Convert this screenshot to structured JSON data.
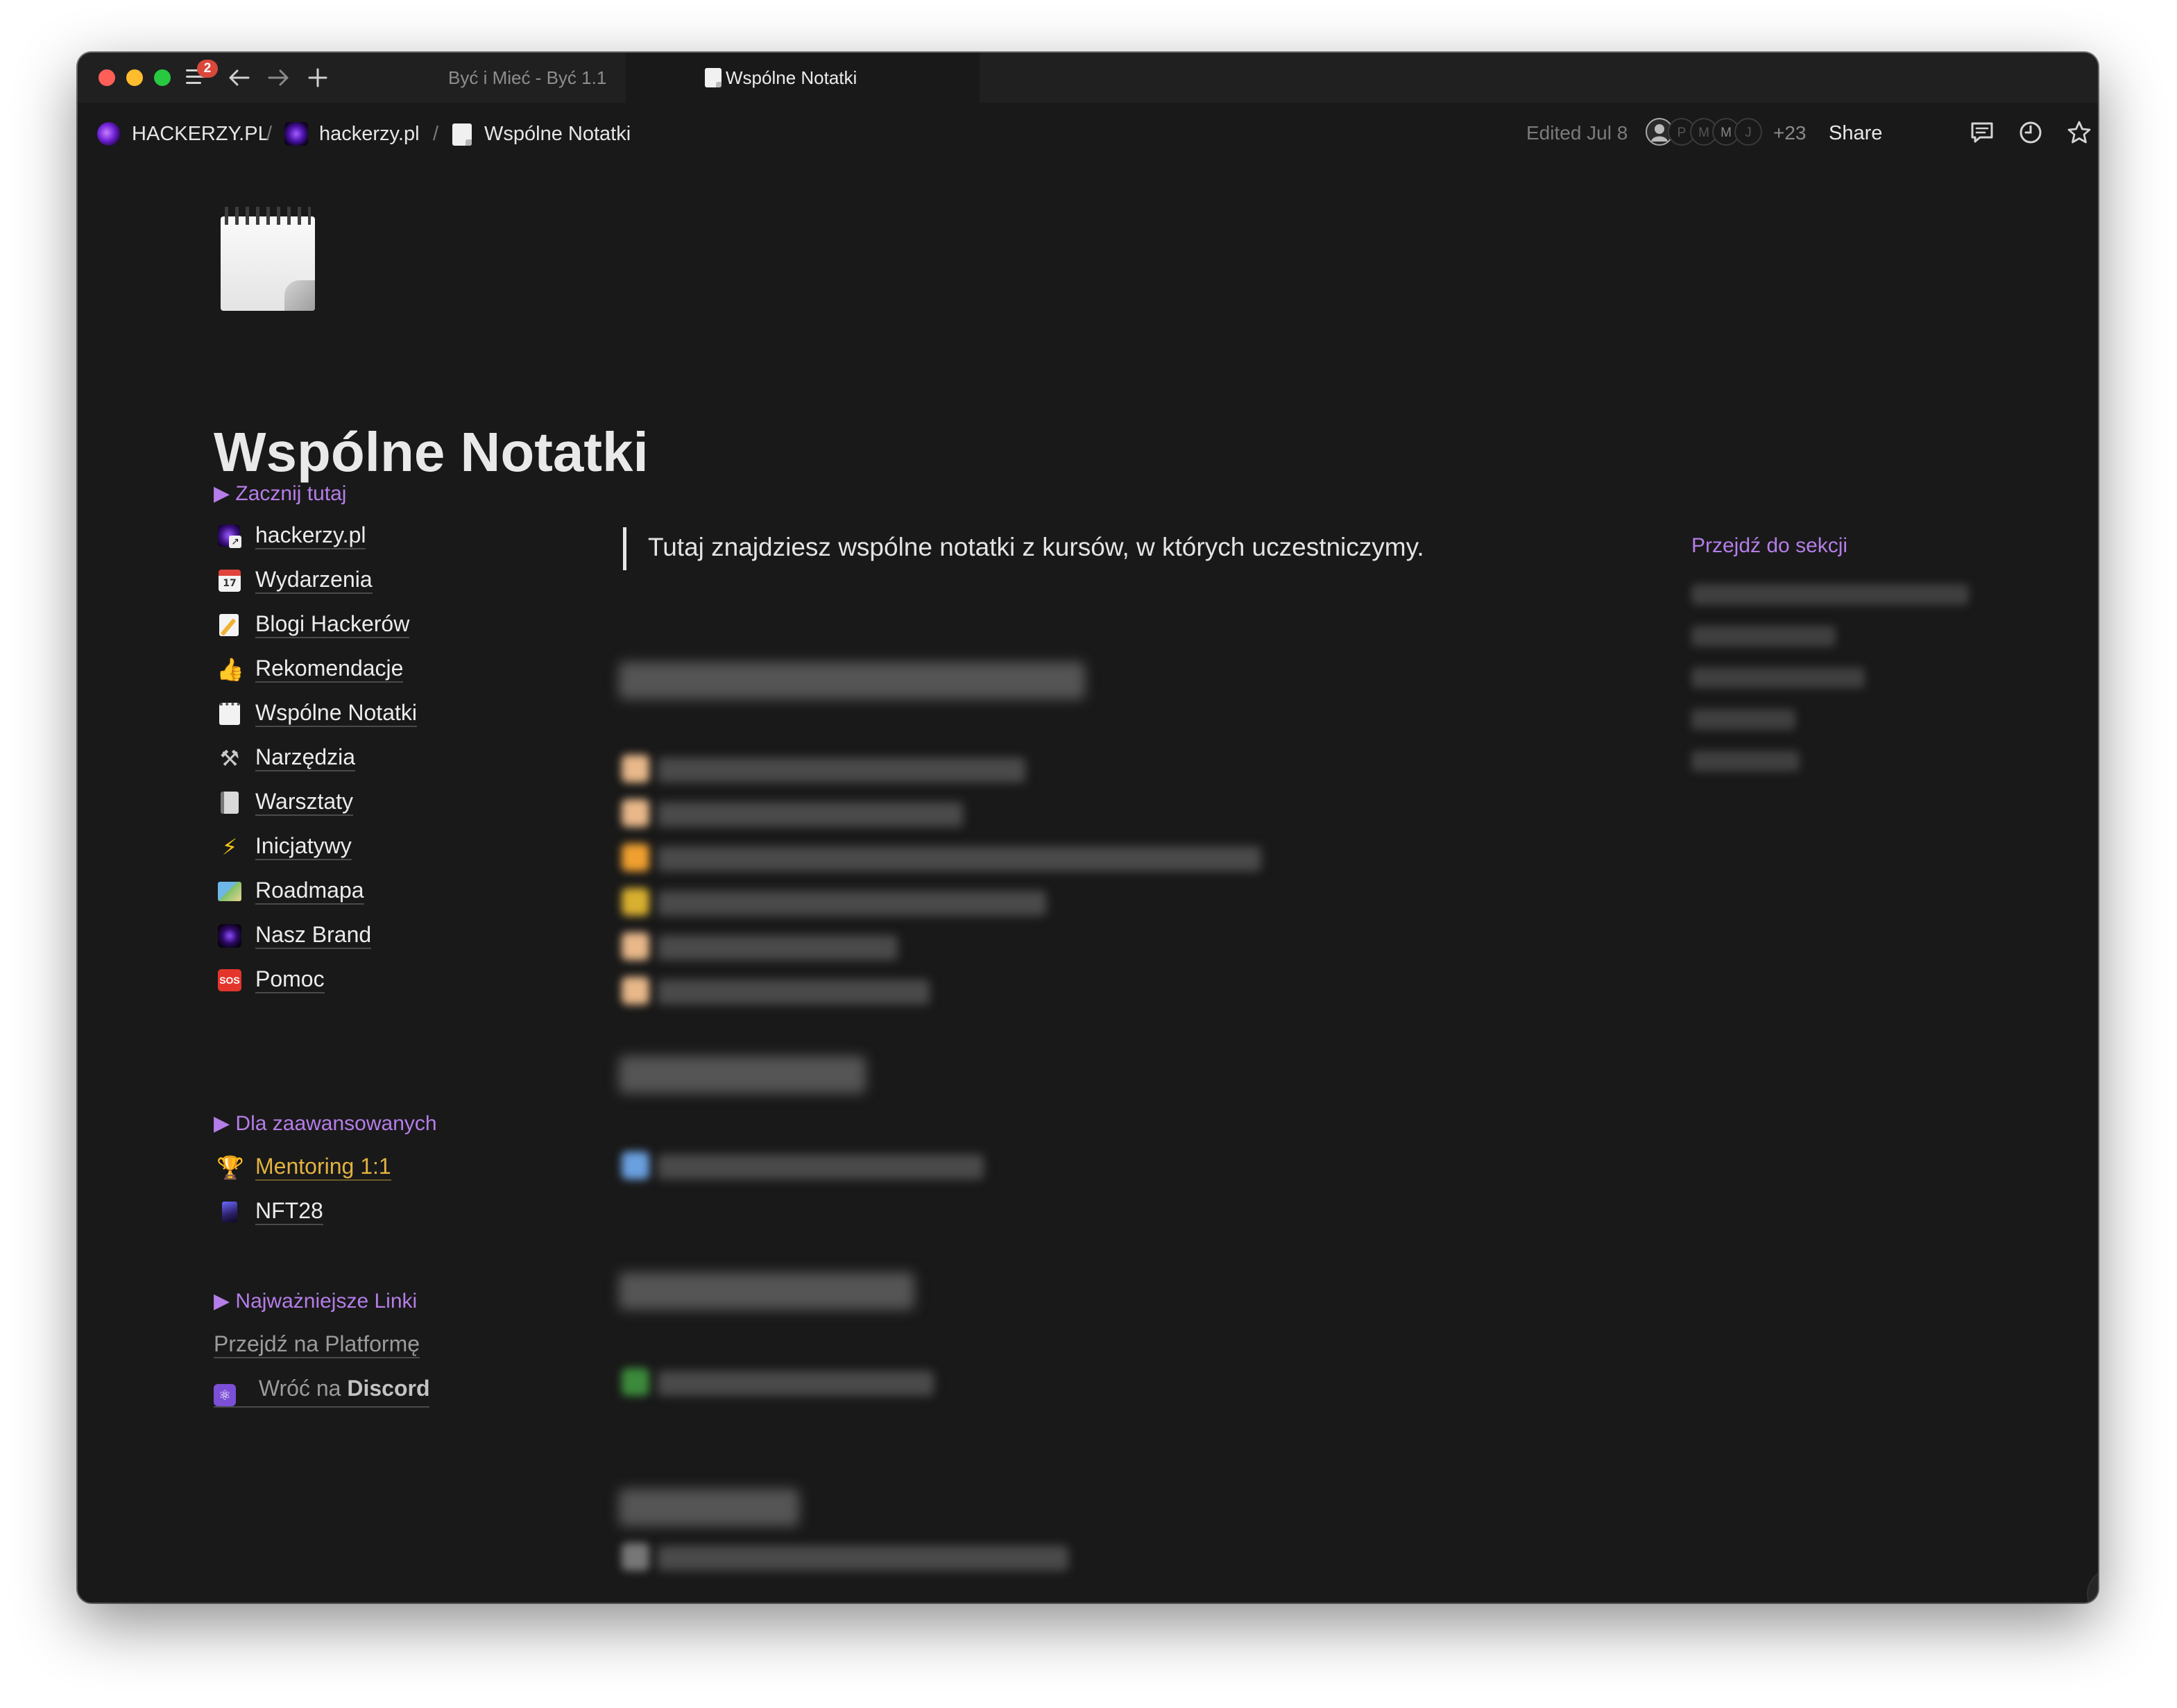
{
  "tabbar": {
    "badge_count": "2",
    "tabs": [
      {
        "label": "Być i Mieć - Być 1.1",
        "active": false
      },
      {
        "label": "Wspólne Notatki",
        "active": true
      }
    ]
  },
  "topbar": {
    "breadcrumbs": [
      {
        "label": "HACKERZY.PL",
        "icon": "hackerzy-logo-icon"
      },
      {
        "label": "hackerzy.pl",
        "icon": "hackerzy-square-icon"
      },
      {
        "label": "Wspólne Notatki",
        "icon": "notepad-icon"
      }
    ],
    "separator": "/",
    "edited": "Edited Jul 8",
    "avatars": [
      "",
      "P",
      "M",
      "M",
      "J"
    ],
    "more_count": "+23",
    "share_label": "Share"
  },
  "page": {
    "icon": "notepad-icon",
    "title": "Wspólne Notatki",
    "quote": "Tutaj znajdziesz wspólne notatki z kursów, w których uczestniczymy."
  },
  "sidebar": {
    "start_heading": "▶ Zacznij tutaj",
    "items": [
      {
        "label": "hackerzy.pl",
        "icon": "hackerzy-link-icon"
      },
      {
        "label": "Wydarzenia",
        "icon": "calendar-icon"
      },
      {
        "label": "Blogi Hackerów",
        "icon": "memo-icon"
      },
      {
        "label": "Rekomendacje",
        "icon": "thumbs-up-icon"
      },
      {
        "label": "Wspólne Notatki",
        "icon": "notepad-icon"
      },
      {
        "label": "Narzędzia",
        "icon": "hammer-pick-icon"
      },
      {
        "label": "Warsztaty",
        "icon": "calendar-tearoff-icon"
      },
      {
        "label": "Inicjatywy",
        "icon": "lightning-icon"
      },
      {
        "label": "Roadmapa",
        "icon": "map-icon"
      },
      {
        "label": "Nasz Brand",
        "icon": "brand-logo-icon"
      },
      {
        "label": "Pomoc",
        "icon": "sos-icon"
      }
    ],
    "advanced_heading": "▶ Dla zaawansowanych",
    "advanced_items": [
      {
        "label": "Mentoring 1:1",
        "icon": "trophy-icon"
      },
      {
        "label": "NFT28",
        "icon": "nft-icon"
      }
    ],
    "links_heading": "▶ Najważniejsze Linki",
    "platform_link": "Przejdź na Platformę",
    "discord_prefix": "Wróć na",
    "discord_name": "Discord"
  },
  "toc": {
    "heading": "Przejdź do sekcji"
  },
  "colors": {
    "background": "#191919",
    "accent_purple": "#b57de8",
    "gold": "#e3b341",
    "text": "#ececec"
  }
}
